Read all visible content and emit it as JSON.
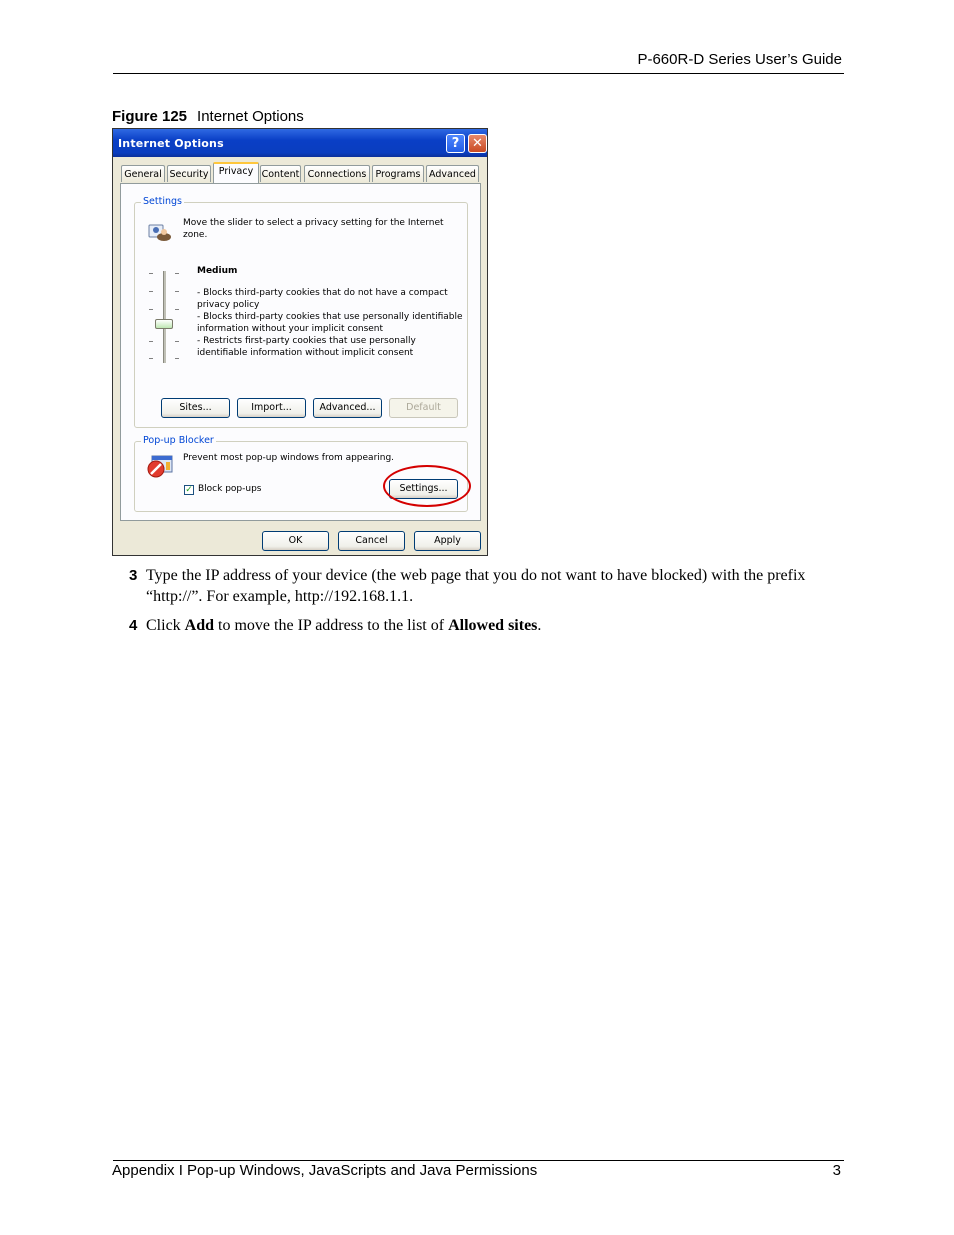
{
  "header": {
    "title": "P-660R-D Series User’s Guide"
  },
  "figure": {
    "number": "Figure 125",
    "title": "Internet Options"
  },
  "dialog": {
    "title": "Internet Options",
    "help_glyph": "?",
    "close_glyph": "✕",
    "tabs": [
      "General",
      "Security",
      "Privacy",
      "Content",
      "Connections",
      "Programs",
      "Advanced"
    ],
    "active_tab": "Privacy",
    "settings": {
      "legend": "Settings",
      "intro": "Move the slider to select a privacy setting for the Internet zone.",
      "level": "Medium",
      "bullets": [
        "- Blocks third-party cookies that do not have a compact privacy policy",
        "- Blocks third-party cookies that use personally identifiable information without your implicit consent",
        "- Restricts first-party cookies that use personally identifiable information without implicit consent"
      ],
      "buttons": {
        "sites": "Sites...",
        "import": "Import...",
        "advanced": "Advanced...",
        "default": "Default"
      }
    },
    "popup": {
      "legend": "Pop-up Blocker",
      "description": "Prevent most pop-up windows from appearing.",
      "checkbox_label": "Block pop-ups",
      "checkbox_checked": true,
      "settings_button": "Settings..."
    },
    "footer_buttons": {
      "ok": "OK",
      "cancel": "Cancel",
      "apply": "Apply"
    },
    "highlight_color": "#d40000"
  },
  "steps": [
    {
      "num": "3",
      "text_before": "Type the IP address of your device (the web page that you do not want to have blocked) with the prefix “http://”. For example, http://192.168.1.1."
    },
    {
      "num": "4",
      "text_1": "Click ",
      "bold_1": "Add",
      "text_2": " to move the IP address to the list of ",
      "bold_2": "Allowed sites",
      "text_3": "."
    }
  ],
  "footer": {
    "left": "Appendix I Pop-up Windows, JavaScripts and Java Permissions",
    "page": "3"
  }
}
